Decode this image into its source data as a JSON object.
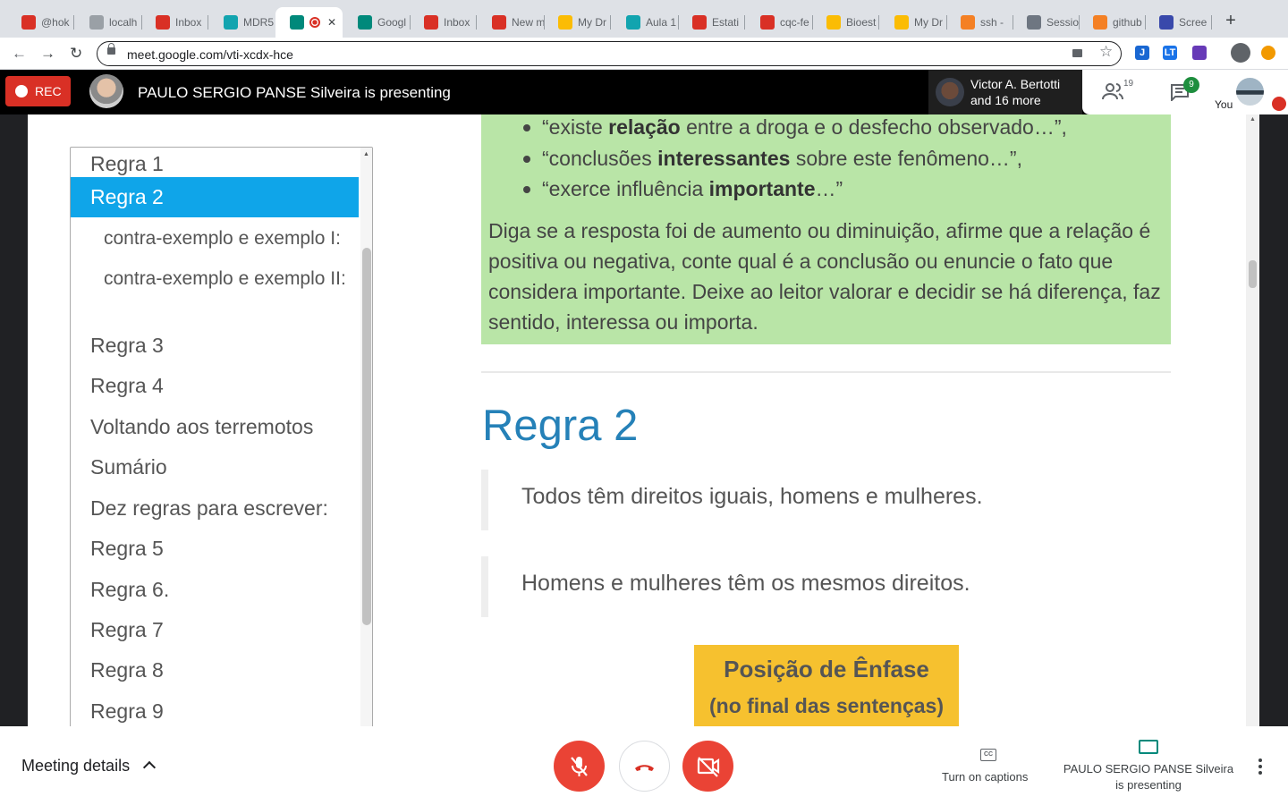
{
  "browser": {
    "tabs": [
      {
        "title": "@hok",
        "favicon": "red-square-icon",
        "color": "#d93025"
      },
      {
        "title": "localh",
        "favicon": "globe-icon",
        "color": "#9aa0a6"
      },
      {
        "title": "Inbox",
        "favicon": "gmail-icon",
        "color": "#d93025"
      },
      {
        "title": "MDR5",
        "favicon": "classroom-icon",
        "color": "#12a4af"
      },
      {
        "title": "",
        "favicon": "hangouts-meet-icon",
        "color": "#00897b",
        "active": true,
        "recording_dot": true
      },
      {
        "title": "Googl",
        "favicon": "hangouts-meet-icon",
        "color": "#00897b"
      },
      {
        "title": "Inbox",
        "favicon": "gmail-icon",
        "color": "#d93025"
      },
      {
        "title": "New m",
        "favicon": "gmail-icon",
        "color": "#d93025"
      },
      {
        "title": "My Dr",
        "favicon": "drive-icon",
        "color": "#fbbc04"
      },
      {
        "title": "Aula 1",
        "favicon": "classroom-icon",
        "color": "#12a4af"
      },
      {
        "title": "Estati",
        "favicon": "pdf-icon",
        "color": "#d93025"
      },
      {
        "title": "cqc-fe",
        "favicon": "calendar-icon",
        "color": "#d93025"
      },
      {
        "title": "Bioest",
        "favicon": "drive-icon",
        "color": "#fbbc04"
      },
      {
        "title": "My Dr",
        "favicon": "drive-icon",
        "color": "#fbbc04"
      },
      {
        "title": "ssh -",
        "favicon": "stackoverflow-icon",
        "color": "#f48024"
      },
      {
        "title": "Sessio",
        "favicon": "github-icon",
        "color": "#6e7681"
      },
      {
        "title": "github",
        "favicon": "stackoverflow-icon",
        "color": "#f48024"
      },
      {
        "title": "Scree",
        "favicon": "screencast-icon",
        "color": "#3949ab"
      }
    ],
    "new_tab_glyph": "+",
    "url": "meet.google.com/vti-xcdx-hce",
    "extensions": [
      {
        "label": "J",
        "color": "#1967d2"
      },
      {
        "label": "LT",
        "color": "#1a73e8"
      },
      {
        "label": "",
        "color": "#673ab7"
      },
      {
        "label": "",
        "color": "#5f6368"
      },
      {
        "label": "",
        "color": "#f29900"
      }
    ]
  },
  "meet_header": {
    "rec_label": "REC",
    "presenting_text": "PAULO SERGIO PANSE Silveira is presenting",
    "participant_name": "Victor A. Bertotti",
    "participant_more": "and 16 more",
    "people_count": "19",
    "chat_badge": "9",
    "you_label": "You"
  },
  "slide": {
    "toc_items": [
      {
        "label": "Regra 1"
      },
      {
        "label": "Regra 2",
        "selected": true
      },
      {
        "label": "contra-exemplo e exemplo I:",
        "sub": true
      },
      {
        "label": "contra-exemplo e exemplo II:",
        "sub": true
      },
      {
        "label": "Regra 3"
      },
      {
        "label": "Regra 4"
      },
      {
        "label": "Voltando aos terremotos"
      },
      {
        "label": "Sumário"
      },
      {
        "label": "Dez regras para escrever:"
      },
      {
        "label": "Regra 5"
      },
      {
        "label": "Regra 6."
      },
      {
        "label": "Regra 7"
      },
      {
        "label": "Regra 8"
      },
      {
        "label": "Regra 9"
      }
    ],
    "bullets": [
      {
        "before": "“existe ",
        "bold": "relação",
        "after": " entre a droga e o desfecho observado…”,"
      },
      {
        "before": "“conclusões ",
        "bold": "interessantes",
        "after": " sobre este fenômeno…”,"
      },
      {
        "before": "“exerce influência ",
        "bold": "importante",
        "after": "…”"
      }
    ],
    "paragraph": "Diga se a resposta foi de aumento ou diminuição, afirme que a relação é positiva ou negativa, conte qual é a conclusão ou enuncie o fato que considera importante. Deixe ao leitor valorar e decidir se há diferença, faz sentido, interessa ou importa.",
    "title": "Regra 2",
    "quote1": "Todos têm direitos iguais, homens e mulheres.",
    "quote2": "Homens e mulheres têm os mesmos direitos.",
    "emphasis_line1": "Posição de Ênfase",
    "emphasis_line2": "(no final das sentenças)"
  },
  "bottom_bar": {
    "meeting_details": "Meeting details",
    "captions_label": "Turn on captions",
    "captions_icon_text": "CC",
    "presenting_label": "PAULO SERGIO PANSE Silveira is presenting"
  },
  "colors": {
    "rec_red": "#d93025",
    "toc_selected": "#0fa5e9",
    "green_box": "#b9e5a7",
    "title_blue": "#2581b8",
    "emphasis_yellow": "#f6c12f",
    "control_red": "#ea4335"
  }
}
